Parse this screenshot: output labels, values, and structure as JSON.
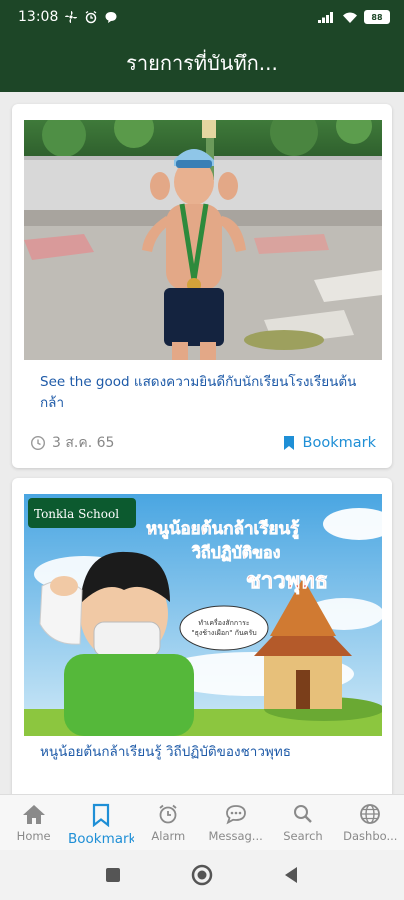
{
  "status_bar": {
    "time": "13:08",
    "battery": "88"
  },
  "app_bar": {
    "title": "รายการที่บันทึก..."
  },
  "cards": [
    {
      "title": "See the good  แสดงความยินดีกับนักเรียนโรงเรียนต้นกล้า",
      "date": "3 ส.ค. 65",
      "bookmark_label": "Bookmark"
    },
    {
      "title": "หนูน้อยต้นกล้าเรียนรู้ วิถีปฏิบัติของชาวพุทธ",
      "poster": {
        "logo_text": "Tonkla School",
        "headline_1": "หนูน้อยต้นกล้าเรียนรู้",
        "headline_2": "วิถีปฏิบัติของ",
        "headline_3": "ชาวพุทธ",
        "bubble_text": "ทำเครื่องสักการะ \"ธุงช้างเผือก\" กันครับ"
      }
    }
  ],
  "bottom_nav": [
    {
      "label": "Home",
      "icon": "home-icon",
      "active": false
    },
    {
      "label": "Bookmark",
      "icon": "bookmark-icon",
      "active": true
    },
    {
      "label": "Alarm",
      "icon": "alarm-icon",
      "active": false
    },
    {
      "label": "Messag...",
      "icon": "message-icon",
      "active": false
    },
    {
      "label": "Search",
      "icon": "search-icon",
      "active": false
    },
    {
      "label": "Dashbo...",
      "icon": "globe-icon",
      "active": false
    }
  ],
  "colors": {
    "header": "#1d4627",
    "accent": "#1f8fd6",
    "title_text": "#1f5ba8"
  }
}
